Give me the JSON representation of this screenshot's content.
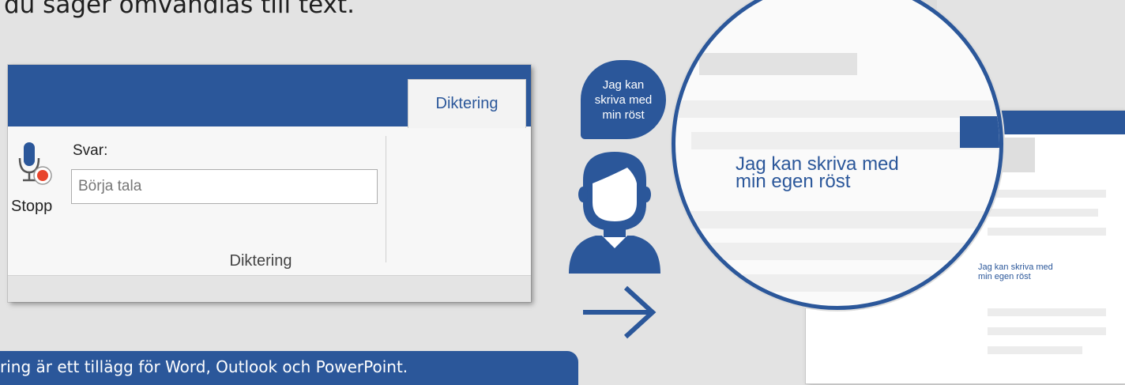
{
  "heading": "du säger omvandlas till text.",
  "ribbon": {
    "tab_label": "Diktering",
    "stop_label": "Stopp",
    "response_label": "Svar:",
    "input_placeholder": "Börja tala",
    "group_label": "Diktering"
  },
  "speech_bubble": {
    "line1": "Jag kan",
    "line2": "skriva med",
    "line3": "min röst"
  },
  "magnified_text": {
    "line1": "Jag kan skriva med",
    "line2": "min egen röst"
  },
  "document_text": {
    "line1": "Jag kan skriva med",
    "line2": "min egen röst"
  },
  "banner_text": "ring är ett tillägg för Word, Outlook och PowerPoint.",
  "colors": {
    "accent": "#2b579a",
    "background": "#e3e3e3",
    "ribbon_body": "#f3f3f3",
    "record_dot": "#e8452c"
  },
  "icons": {
    "mic": "microphone-record-icon",
    "user": "user-icon",
    "arrow": "arrow-right-icon"
  }
}
